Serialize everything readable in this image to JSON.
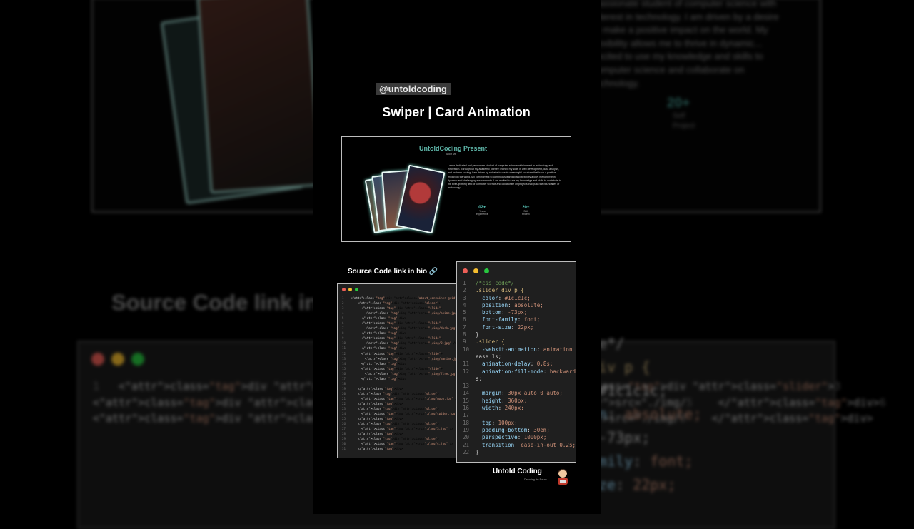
{
  "background": {
    "paragraph": "Passionate student of computer science with interest in technology. I am driven by a desire to make a positive impact on the world. My flexibility allows me to thrive in dynamic... excited to use my knowledge and skills to computer science and collaborate on technology.",
    "stat_value": "20+",
    "stat_label_1": "Self",
    "stat_label_2": "Project",
    "title": "Source Code link in bio",
    "code_lines": [
      {
        "n": "1",
        "t": "<div class=\"about_container grid\">"
      },
      {
        "n": "2",
        "t": "    <div class=\"slider\">"
      },
      {
        "n": "3",
        "t": "      <div class=\"slide\">"
      },
      {
        "n": "4",
        "t": "        <img src=\"./img/"
      },
      {
        "n": "5",
        "t": "      </div>"
      },
      {
        "n": "6",
        "t": "      <div class=\"slide\""
      },
      {
        "n": "7",
        "t": "        <img src=\"./img/"
      },
      {
        "n": "8",
        "t": "      </div>"
      }
    ],
    "right_code": [
      "e*/",
      "iv p {",
      "#1c1c1c;",
      "n: absolute;",
      "-73px;",
      "mily: font;",
      "ze: 22px;"
    ]
  },
  "handle": "@untoldcoding",
  "title": "Swiper | Card Animation",
  "preview": {
    "heading": "UntoldCoding Present",
    "subheading": "About Me",
    "paragraph": "I am a dedicated and passionate student of computer science with interest in technology and innovation. Throughout my academic journey I honed my skills in web development, data analysis, and problem solving. I am driven by a desire to create meaningful solutions that have a positive impact on the world. My commitment to continuous learning and flexibility allows me to thrive in dynamic and challenging environments. I am excited to use my knowledge and skills to contribute to the ever-growing field of computer science and collaborate on projects that push the boundaries of technology.",
    "stats": [
      {
        "value": "02+",
        "label1": "Years",
        "label2": "experience"
      },
      {
        "value": "20+",
        "label1": "Self",
        "label2": "Project"
      }
    ]
  },
  "source_link": "Source Code link in bio 🔗",
  "html_code": [
    {
      "n": "1",
      "t": "<div class=\"about_container grid\">"
    },
    {
      "n": "2",
      "t": "    <div class=\"slider\">"
    },
    {
      "n": "3",
      "t": "      <div class=\"slide\">"
    },
    {
      "n": "4",
      "t": "        <img src=\"./img/anime.jpg\" />"
    },
    {
      "n": "5",
      "t": "      </div>"
    },
    {
      "n": "6",
      "t": "      <div class=\"slide\">"
    },
    {
      "n": "7",
      "t": "        <img src=\"./img/dark.jpg\" />"
    },
    {
      "n": "8",
      "t": "      </div>"
    },
    {
      "n": "9",
      "t": "      <div class=\"slide\">"
    },
    {
      "n": "10",
      "t": "        <img src=\"./img/2.jpg\" />"
    },
    {
      "n": "11",
      "t": "      </div>"
    },
    {
      "n": "12",
      "t": "      <div class=\"slide\">"
    },
    {
      "n": "13",
      "t": "        <img src=\"./img/aanime.jpg\" />"
    },
    {
      "n": "14",
      "t": "      </div>"
    },
    {
      "n": "15",
      "t": "      <div class=\"slide\">"
    },
    {
      "n": "16",
      "t": "        <img src=\"./img/fire.jpg\" />"
    },
    {
      "n": "17",
      "t": "      </div>"
    },
    {
      "n": "18",
      "t": ""
    },
    {
      "n": "19",
      "t": "    </div>"
    },
    {
      "n": "20",
      "t": "    <div class=\"slide\">"
    },
    {
      "n": "21",
      "t": "      <img src=\"./img/moon.jpg\" />"
    },
    {
      "n": "22",
      "t": "    </div>"
    },
    {
      "n": "23",
      "t": "    <div class=\"slide\">"
    },
    {
      "n": "24",
      "t": "      <img src=\"./img/spider.jpg\" />"
    },
    {
      "n": "25",
      "t": "    </div>"
    },
    {
      "n": "26",
      "t": "    <div class=\"slide\">"
    },
    {
      "n": "27",
      "t": "      <img src=\"./img/3.jpg\" />"
    },
    {
      "n": "28",
      "t": "    </div>"
    },
    {
      "n": "29",
      "t": "    <div class=\"slide\">"
    },
    {
      "n": "30",
      "t": "      <img src=\"./img/4.jpg\" />"
    },
    {
      "n": "31",
      "t": "    </div>"
    }
  ],
  "css_code": [
    {
      "n": "1",
      "t": "/*css code*/"
    },
    {
      "n": "2",
      "t": ".slider div p {"
    },
    {
      "n": "3",
      "t": "  color: #1c1c1c;"
    },
    {
      "n": "4",
      "t": "  position: absolute;"
    },
    {
      "n": "5",
      "t": "  bottom: -73px;"
    },
    {
      "n": "6",
      "t": "  font-family: font;"
    },
    {
      "n": "7",
      "t": "  font-size: 22px;"
    },
    {
      "n": "8",
      "t": "}"
    },
    {
      "n": "9",
      "t": ".slider {"
    },
    {
      "n": "10",
      "t": "  -webkit-animation: animation"
    },
    {
      "n": "",
      "t": "ease 1s;"
    },
    {
      "n": "11",
      "t": "  animation-delay: 0.8s;"
    },
    {
      "n": "12",
      "t": "  animation-fill-mode: backward"
    },
    {
      "n": "",
      "t": "s;"
    },
    {
      "n": "13",
      "t": ""
    },
    {
      "n": "14",
      "t": "  margin: 30px auto 0 auto;"
    },
    {
      "n": "15",
      "t": "  height: 360px;"
    },
    {
      "n": "16",
      "t": "  width: 240px;"
    },
    {
      "n": "17",
      "t": ""
    },
    {
      "n": "18",
      "t": "  top: 100px;"
    },
    {
      "n": "19",
      "t": "  padding-bottom: 30em;"
    },
    {
      "n": "20",
      "t": "  perspective: 1000px;"
    },
    {
      "n": "21",
      "t": "  transition: ease-in-out 0.2s;"
    },
    {
      "n": "22",
      "t": "}"
    }
  ],
  "logo": {
    "name": "Untold Coding",
    "tagline": "Decoding the Future"
  },
  "colors": {
    "dot_red": "#ed5f57",
    "dot_yellow": "#f5bd2f",
    "dot_green": "#28c840",
    "accent": "#5fb7aa"
  }
}
